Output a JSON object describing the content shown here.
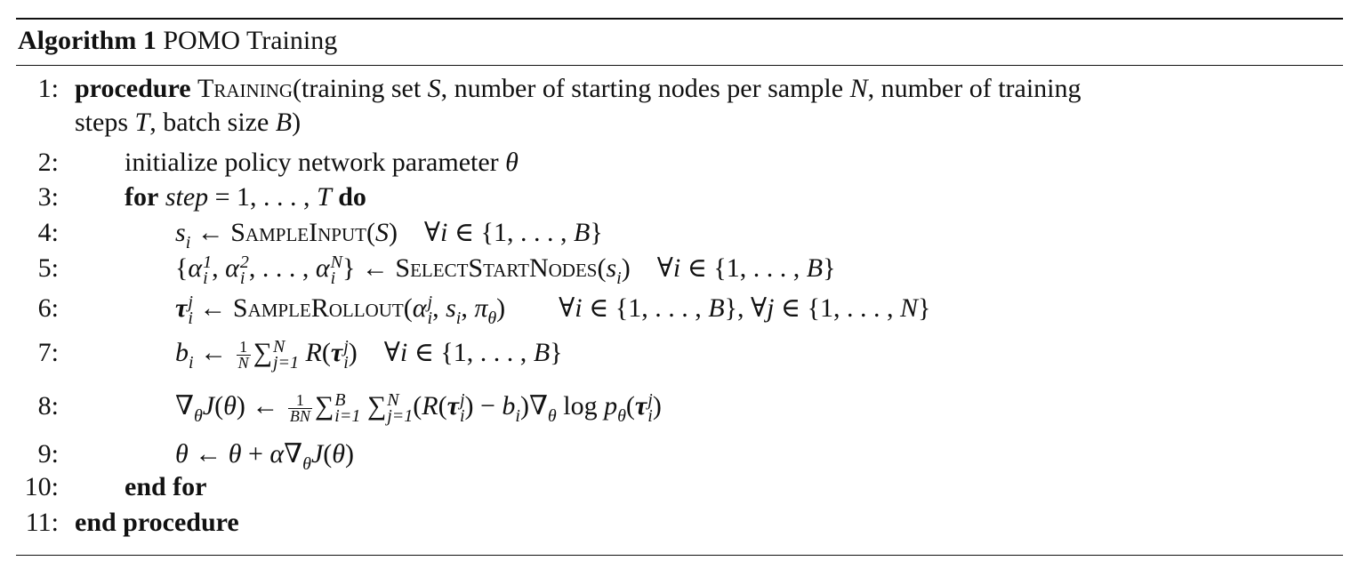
{
  "caption": {
    "label": "Algorithm 1",
    "title": "POMO Training"
  },
  "lines": [
    {
      "num": "1:",
      "indent": 0,
      "seg": [
        [
          "b",
          "procedure"
        ],
        [
          "r",
          " "
        ],
        [
          "sc",
          "Training"
        ],
        [
          "r",
          "(training set "
        ],
        [
          "i",
          "S"
        ],
        [
          "r",
          ", number of starting nodes per sample "
        ],
        [
          "i",
          "N"
        ],
        [
          "r",
          ", number of training"
        ]
      ]
    },
    {
      "num": "",
      "indent": 0,
      "seg": [
        [
          "r",
          "steps "
        ],
        [
          "i",
          "T"
        ],
        [
          "r",
          ", batch size "
        ],
        [
          "i",
          "B"
        ],
        [
          "r",
          ")"
        ]
      ]
    },
    {
      "num": "2:",
      "indent": 1,
      "seg": [
        [
          "r",
          "initialize policy network parameter "
        ],
        [
          "i",
          "θ"
        ]
      ]
    },
    {
      "num": "3:",
      "indent": 1,
      "seg": [
        [
          "b",
          "for"
        ],
        [
          "r",
          " "
        ],
        [
          "i",
          "step"
        ],
        [
          "r",
          " = 1, . . . , "
        ],
        [
          "i",
          "T"
        ],
        [
          "r",
          " "
        ],
        [
          "b",
          "do"
        ]
      ]
    },
    {
      "num": "4:",
      "indent": 2,
      "seg": [
        [
          "i",
          "s"
        ],
        [
          "sub",
          "i"
        ],
        [
          "r",
          " ← "
        ],
        [
          "sc",
          "SampleInput"
        ],
        [
          "r",
          "("
        ],
        [
          "i",
          "S"
        ],
        [
          "r",
          ")    ∀"
        ],
        [
          "i",
          "i"
        ],
        [
          "r",
          " ∈ {1, . . . , "
        ],
        [
          "i",
          "B"
        ],
        [
          "r",
          "}"
        ]
      ]
    },
    {
      "num": "5:",
      "indent": 2,
      "seg": [
        [
          "r",
          "{"
        ],
        [
          "i",
          "α"
        ],
        [
          "ss",
          "1",
          "i"
        ],
        [
          "r",
          ", "
        ],
        [
          "i",
          "α"
        ],
        [
          "ss",
          "2",
          "i"
        ],
        [
          "r",
          ", . . . , "
        ],
        [
          "i",
          "α"
        ],
        [
          "ss",
          "N",
          "i"
        ],
        [
          "r",
          "} ← "
        ],
        [
          "sc",
          "SelectStartNodes"
        ],
        [
          "r",
          "("
        ],
        [
          "i",
          "s"
        ],
        [
          "sub",
          "i"
        ],
        [
          "r",
          ")    ∀"
        ],
        [
          "i",
          "i"
        ],
        [
          "r",
          " ∈ {1, . . . , "
        ],
        [
          "i",
          "B"
        ],
        [
          "r",
          "}"
        ]
      ]
    },
    {
      "num": "6:",
      "indent": 2,
      "seg": [
        [
          "bi",
          "τ"
        ],
        [
          "ss",
          "j",
          "i"
        ],
        [
          "r",
          " ← "
        ],
        [
          "sc",
          "SampleRollout"
        ],
        [
          "r",
          "("
        ],
        [
          "i",
          "α"
        ],
        [
          "ss",
          "j",
          "i"
        ],
        [
          "r",
          ", "
        ],
        [
          "i",
          "s"
        ],
        [
          "sub",
          "i"
        ],
        [
          "r",
          ", "
        ],
        [
          "i",
          "π"
        ],
        [
          "sub",
          "θ"
        ],
        [
          "r",
          ")        ∀"
        ],
        [
          "i",
          "i"
        ],
        [
          "r",
          " ∈ {1, . . . , "
        ],
        [
          "i",
          "B"
        ],
        [
          "r",
          "}, ∀"
        ],
        [
          "i",
          "j"
        ],
        [
          "r",
          " ∈ {1, . . . , "
        ],
        [
          "i",
          "N"
        ],
        [
          "r",
          "}"
        ]
      ]
    },
    {
      "num": "7:",
      "indent": 2,
      "seg": [
        [
          "i",
          "b"
        ],
        [
          "sub",
          "i"
        ],
        [
          "r",
          " ← "
        ],
        [
          "frac",
          "1",
          "N"
        ],
        [
          "sum",
          "∑"
        ],
        [
          "ss",
          "N",
          "j=1"
        ],
        [
          "r",
          " "
        ],
        [
          "i",
          "R"
        ],
        [
          "r",
          "("
        ],
        [
          "bi",
          "τ"
        ],
        [
          "ss",
          "j",
          "i"
        ],
        [
          "r",
          ")    ∀"
        ],
        [
          "i",
          "i"
        ],
        [
          "r",
          " ∈ {1, . . . , "
        ],
        [
          "i",
          "B"
        ],
        [
          "r",
          "}"
        ]
      ]
    },
    {
      "num": "8:",
      "indent": 2,
      "seg": [
        [
          "r",
          "∇"
        ],
        [
          "sub",
          "θ"
        ],
        [
          "i",
          "J"
        ],
        [
          "r",
          "("
        ],
        [
          "i",
          "θ"
        ],
        [
          "r",
          ") ← "
        ],
        [
          "frac",
          "1",
          "BN"
        ],
        [
          "sum",
          "∑"
        ],
        [
          "ss",
          "B",
          "i=1"
        ],
        [
          "r",
          " "
        ],
        [
          "sum",
          "∑"
        ],
        [
          "ss",
          "N",
          "j=1"
        ],
        [
          "r",
          "("
        ],
        [
          "i",
          "R"
        ],
        [
          "r",
          "("
        ],
        [
          "bi",
          "τ"
        ],
        [
          "ss",
          "j",
          "i"
        ],
        [
          "r",
          ") − "
        ],
        [
          "i",
          "b"
        ],
        [
          "sub",
          "i"
        ],
        [
          "r",
          ")∇"
        ],
        [
          "sub",
          "θ"
        ],
        [
          "r",
          " log "
        ],
        [
          "i",
          "p"
        ],
        [
          "sub",
          "θ"
        ],
        [
          "r",
          "("
        ],
        [
          "bi",
          "τ"
        ],
        [
          "ss",
          "j",
          "i"
        ],
        [
          "r",
          ")"
        ]
      ]
    },
    {
      "num": "9:",
      "indent": 2,
      "seg": [
        [
          "i",
          "θ"
        ],
        [
          "r",
          " ← "
        ],
        [
          "i",
          "θ"
        ],
        [
          "r",
          " + "
        ],
        [
          "i",
          "α"
        ],
        [
          "r",
          "∇"
        ],
        [
          "sub",
          "θ"
        ],
        [
          "i",
          "J"
        ],
        [
          "r",
          "("
        ],
        [
          "i",
          "θ"
        ],
        [
          "r",
          ")"
        ]
      ]
    },
    {
      "num": "10:",
      "indent": 1,
      "seg": [
        [
          "b",
          "end for"
        ]
      ]
    },
    {
      "num": "11:",
      "indent": 0,
      "seg": [
        [
          "b",
          "end procedure"
        ]
      ]
    }
  ]
}
